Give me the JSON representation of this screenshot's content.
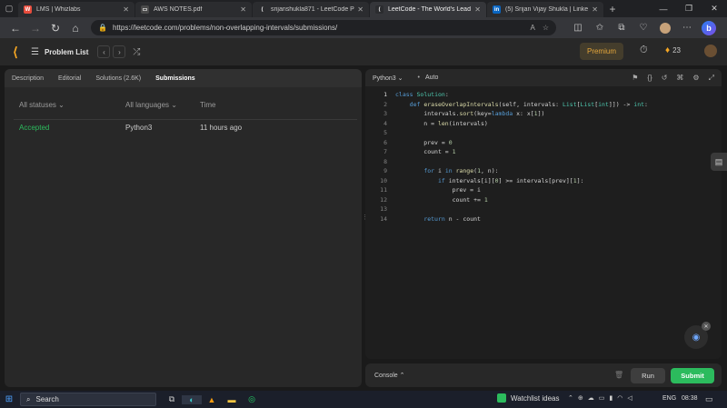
{
  "browser": {
    "tabs": [
      {
        "title": "LMS | Whizlabs",
        "icon": "whizlabs-icon",
        "color": "#e74c3c",
        "glyph": "W",
        "active": false
      },
      {
        "title": "AWS NOTES.pdf",
        "icon": "pdf-icon",
        "color": "#4a4a4a",
        "glyph": "▭",
        "active": false
      },
      {
        "title": "srijanshukla871 - LeetCode P",
        "icon": "leetcode-icon",
        "color": "#2b2c2f",
        "glyph": "⟨",
        "active": false
      },
      {
        "title": "LeetCode - The World's Lead",
        "icon": "leetcode-icon",
        "color": "#2b2c2f",
        "glyph": "⟨",
        "active": true
      },
      {
        "title": "(5) Srijan Vijay Shukla | Linke",
        "icon": "linkedin-icon",
        "color": "#0a66c2",
        "glyph": "in",
        "active": false
      }
    ],
    "url": "https://leetcode.com/problems/non-overlapping-intervals/submissions/"
  },
  "header": {
    "problem_list": "Problem List",
    "premium": "Premium",
    "streak": "23"
  },
  "left": {
    "tabs": [
      {
        "label": "Description",
        "active": false
      },
      {
        "label": "Editorial",
        "active": false
      },
      {
        "label": "Solutions (2.6K)",
        "active": false
      },
      {
        "label": "Submissions",
        "active": true
      }
    ],
    "filters": {
      "status": "All statuses",
      "language": "All languages",
      "time": "Time"
    },
    "submissions": [
      {
        "status": "Accepted",
        "language": "Python3",
        "time": "11 hours ago"
      }
    ]
  },
  "editor": {
    "language": "Python3",
    "mode": "Auto",
    "lines": [
      "class Solution:",
      "    def eraseOverlapIntervals(self, intervals: List[List[int]]) -> int:",
      "        intervals.sort(key=lambda x: x[1])",
      "        n = len(intervals)",
      "",
      "        prev = 0",
      "        count = 1",
      "",
      "        for i in range(1, n):",
      "            if intervals[i][0] >= intervals[prev][1]:",
      "                prev = i",
      "                count += 1",
      "",
      "        return n - count"
    ]
  },
  "console": {
    "label": "Console",
    "run": "Run",
    "submit": "Submit"
  },
  "taskbar": {
    "search": "Search",
    "watchlist": "Watchlist ideas",
    "lang": "ENG",
    "time": "08:38"
  }
}
